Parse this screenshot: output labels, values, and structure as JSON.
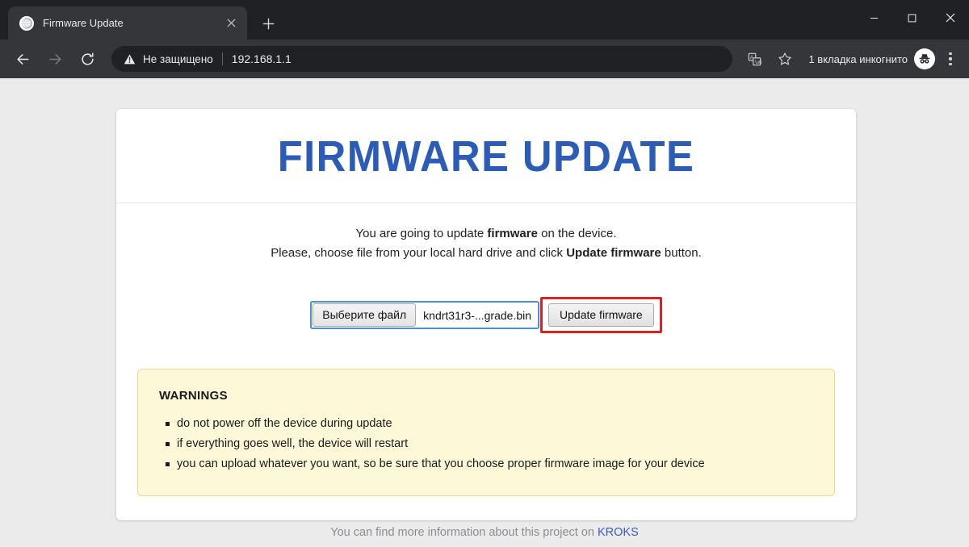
{
  "browser": {
    "tab": {
      "title": "Firmware Update",
      "favicon_name": "globe-icon",
      "close_label": "×"
    },
    "new_tab_label": "+",
    "window_controls": {
      "minimize": "—",
      "maximize": "□",
      "close": "✕"
    },
    "toolbar": {
      "back_label": "←",
      "forward_label": "→",
      "reload_label": "↻",
      "security_text": "Не защищено",
      "url": "192.168.1.1",
      "translate_icon": "translate-icon",
      "bookmark_icon": "star-icon",
      "incognito_label": "1 вкладка инкогнито",
      "menu_icon": "three-dot-menu-icon"
    }
  },
  "page": {
    "title": "FIRMWARE UPDATE",
    "intro_line1_before": "You are going to update ",
    "intro_line1_bold": "firmware",
    "intro_line1_after": " on the device.",
    "intro_line2_before": "Please, choose file from your local hard drive and click ",
    "intro_line2_bold": "Update firmware",
    "intro_line2_after": " button.",
    "file_button_label": "Выберите файл",
    "file_name": "kndrt31r3-...grade.bin",
    "submit_label": "Update firmware",
    "warnings_title": "WARNINGS",
    "warnings": [
      "do not power off the device during update",
      "if everything goes well, the device will restart",
      "you can upload whatever you want, so be sure that you choose proper firmware image for your device"
    ],
    "footer_text": "You can find more information about this project on ",
    "footer_link": "KROKS"
  },
  "colors": {
    "title_blue": "#2b5cb8",
    "warning_bg": "#fcf8d8",
    "warning_border": "#e8dc8a",
    "highlight_red": "#e02020",
    "focus_blue": "#4a90d9",
    "link_blue": "#3b5bc0",
    "page_bg": "#ebebeb",
    "chrome_dark": "#202124",
    "toolbar_dark": "#35363a"
  }
}
